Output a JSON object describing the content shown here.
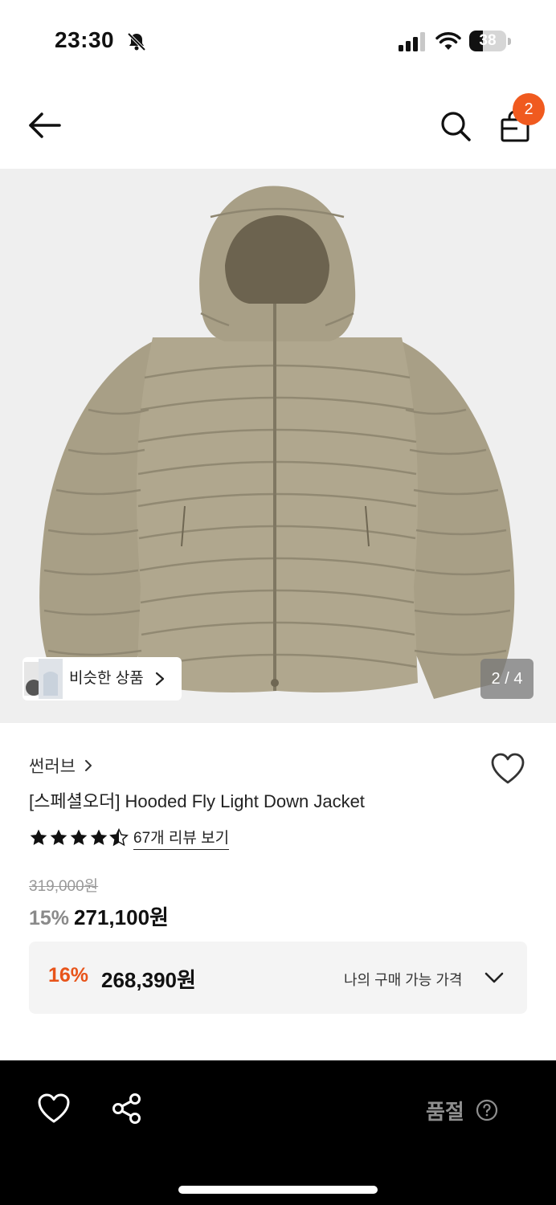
{
  "status_bar": {
    "time": "23:30",
    "battery": "38",
    "battery_level": 0.38,
    "icons": [
      "bell-off-icon",
      "signal-icon",
      "wifi-icon",
      "battery-icon"
    ]
  },
  "header": {
    "back_icon": "arrow-left-icon",
    "search_icon": "search-icon",
    "cart_icon": "shopping-bag-icon",
    "cart_count": "2"
  },
  "gallery": {
    "similar_label": "비슷한 상품",
    "page_indicator": "2 / 4",
    "current_page": 2,
    "total_pages": 4
  },
  "product": {
    "brand": "썬러브",
    "title": "[스페셜오더] Hooded Fly Light Down Jacket",
    "rating": 4.5,
    "review_link": "67개 리뷰 보기",
    "original_price": "319,000원",
    "discount_pct": "15%",
    "sale_price": "271,100원"
  },
  "my_price": {
    "discount_pct": "16%",
    "price": "268,390원",
    "label": "나의 구매 가능 가격"
  },
  "bottom_bar": {
    "status": "품절"
  },
  "colors": {
    "accent": "#f05a1f",
    "my_discount": "#e8541a",
    "jacket": "#a89f86",
    "bottom_bar": "#000000"
  }
}
